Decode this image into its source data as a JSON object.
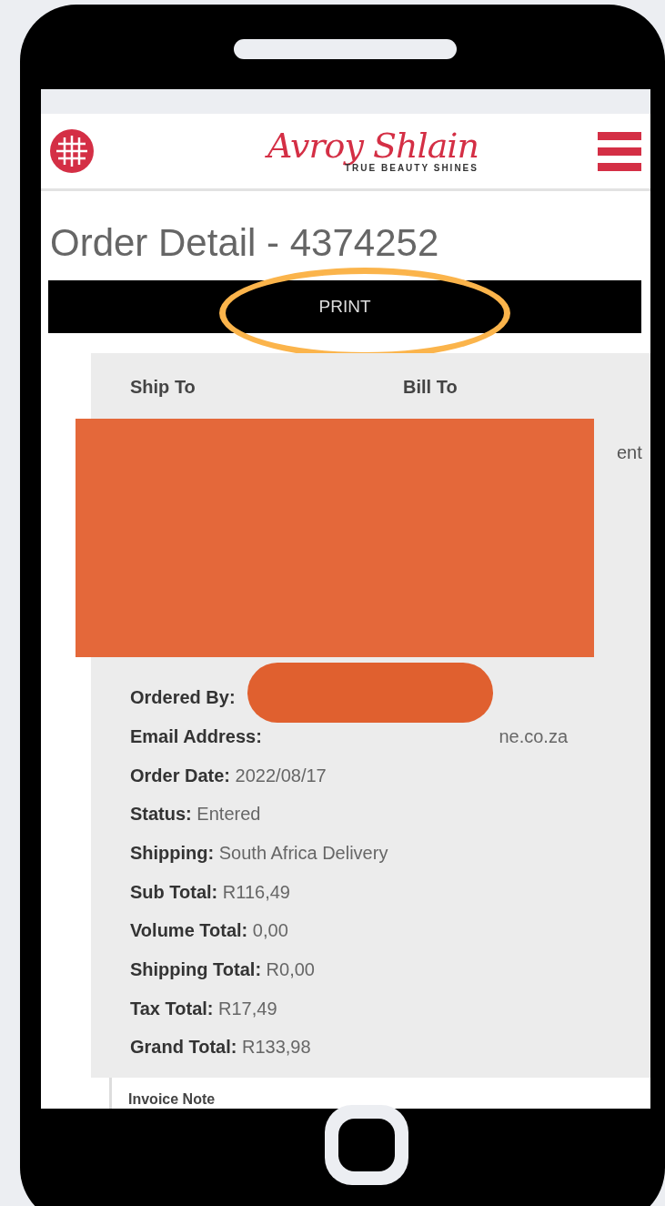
{
  "header": {
    "logo": "Avroy Shlain",
    "tagline": "TRUE BEAUTY SHINES"
  },
  "title": "Order Detail - 4374252",
  "print_button": "PRINT",
  "addresses": {
    "ship_to": "Ship To",
    "bill_to": "Bill To",
    "bill_to_fragment": "ent"
  },
  "details": [
    {
      "label": "Ordered By:"
    },
    {
      "label": "Email Address:",
      "value": "ne.co.za"
    },
    {
      "label": "Order Date:",
      "value": "2022/08/17"
    },
    {
      "label": "Status:",
      "value": "Entered"
    },
    {
      "label": "Shipping:",
      "value": "South Africa Delivery"
    },
    {
      "label": "Sub Total:",
      "value": "R116,49"
    },
    {
      "label": "Volume Total:",
      "value": "0,00"
    },
    {
      "label": "Shipping Total:",
      "value": "R0,00"
    },
    {
      "label": "Tax Total:",
      "value": "R17,49"
    },
    {
      "label": "Grand Total:",
      "value": "R133,98"
    }
  ],
  "invoice_note": "Invoice Note"
}
